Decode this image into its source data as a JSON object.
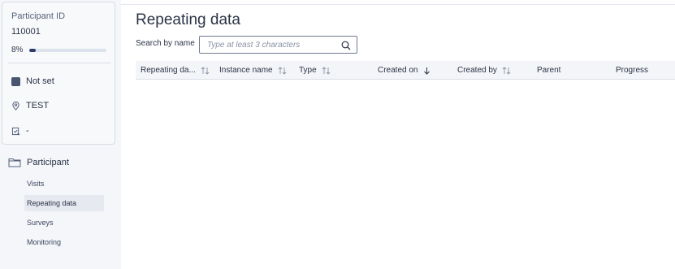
{
  "participant": {
    "id_label": "Participant ID",
    "id_value": "110001",
    "progress_label": "8%",
    "progress_fraction": 0.08,
    "status": "Not set",
    "site": "TEST",
    "checklist": "-"
  },
  "nav": {
    "folder_label": "Participant",
    "items": [
      "Visits",
      "Repeating data",
      "Surveys",
      "Monitoring"
    ],
    "active": "Repeating data"
  },
  "main": {
    "title": "Repeating data",
    "search_label": "Search by name",
    "search_placeholder": "Type at least 3 characters",
    "columns": [
      {
        "label": "Repeating da...",
        "sort": "both"
      },
      {
        "label": "Instance name",
        "sort": "both"
      },
      {
        "label": "Type",
        "sort": "both"
      },
      {
        "label": "Created on",
        "sort": "desc"
      },
      {
        "label": "Created by",
        "sort": "both"
      },
      {
        "label": "Parent",
        "sort": "none"
      },
      {
        "label": "Progress",
        "sort": "none"
      }
    ]
  },
  "colors": {
    "accent": "#2f3c6b",
    "panel_bg": "#f4f6f9",
    "border": "#d7dde5"
  }
}
